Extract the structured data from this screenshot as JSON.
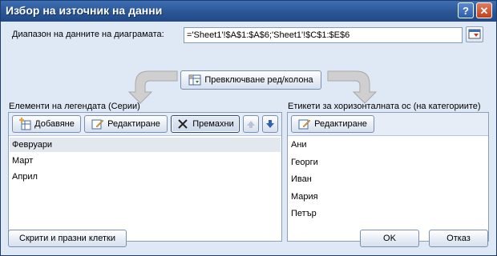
{
  "window": {
    "title": "Избор на източник на данни"
  },
  "titlebar": {
    "help_glyph": "?",
    "close_glyph": "✕"
  },
  "range": {
    "label": "Диапазон на данните на диаграмата:",
    "value": "='Sheet1'!$A$1:$A$6;'Sheet1'!$C$1:$E$6"
  },
  "switch": {
    "label": "Превключване ред/колона"
  },
  "legend": {
    "header": "Елементи на легендата (Серии)",
    "add_label": "Добавяне",
    "edit_label": "Редактиране",
    "remove_label": "Премахни",
    "items": [
      "Февруари",
      "Март",
      "Април"
    ],
    "selected_index": 0
  },
  "axis": {
    "header": "Етикети за хоризонталната ос (на категориите)",
    "edit_label": "Редактиране",
    "items": [
      "Ани",
      "Георги",
      "Иван",
      "Мария",
      "Петър"
    ]
  },
  "footer": {
    "hidden_cells_label": "Скрити и празни клетки",
    "ok_label": "OK",
    "cancel_label": "Отказ"
  },
  "icons": {
    "add": "add-series-icon",
    "edit": "edit-icon",
    "remove": "remove-x-icon",
    "up": "move-up-icon",
    "down": "move-down-icon",
    "switch": "switch-row-column-icon",
    "collapse": "collapse-dialog-icon"
  }
}
